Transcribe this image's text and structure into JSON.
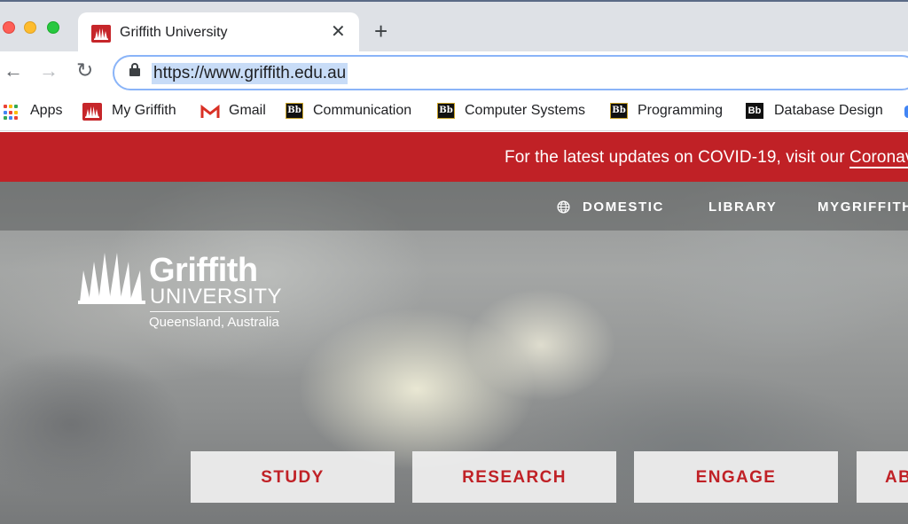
{
  "browser": {
    "tab": {
      "title": "Griffith University",
      "close_glyph": "✕",
      "favicon": "griffith-logo-icon"
    },
    "new_tab_glyph": "+",
    "toolbar": {
      "back_glyph": "←",
      "forward_glyph": "→",
      "reload_glyph": "↻",
      "url": "https://www.griffith.edu.au"
    },
    "bookmarks": [
      {
        "label": "Apps",
        "icon": "apps-grid-icon"
      },
      {
        "label": "My Griffith",
        "icon": "griffith-logo-icon"
      },
      {
        "label": "Gmail",
        "icon": "gmail-icon"
      },
      {
        "label": "Communication",
        "icon": "blackboard-icon"
      },
      {
        "label": "Computer Systems",
        "icon": "blackboard-icon"
      },
      {
        "label": "Programming",
        "icon": "blackboard-icon"
      },
      {
        "label": "Database Design",
        "icon": "blackboard-icon"
      }
    ],
    "bb_icon_text": "Bb"
  },
  "site": {
    "covid_banner": {
      "text": "For the latest updates on COVID-19, visit our ",
      "link": "Coronavir"
    },
    "utility_nav": [
      "DOMESTIC",
      "LIBRARY",
      "MYGRIFFITH"
    ],
    "logo": {
      "name": "Griffith",
      "subtitle": "UNIVERSITY",
      "location": "Queensland, Australia"
    },
    "main_nav": [
      "STUDY",
      "RESEARCH",
      "ENGAGE",
      "AB"
    ]
  },
  "colors": {
    "brand_red": "#c02126",
    "selection_blue": "#c8dcf7",
    "focus_ring": "#8ab4f8"
  }
}
